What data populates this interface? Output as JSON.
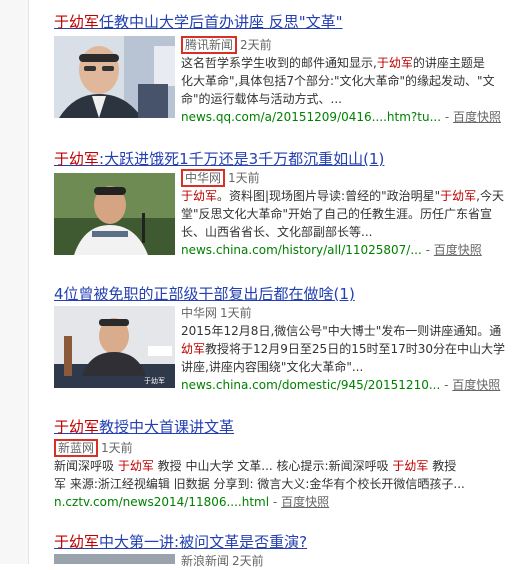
{
  "results": [
    {
      "title_parts": [
        "于幼军",
        "任教中山大学后首办讲座 反思\"文革\""
      ],
      "source": "腾讯新闻",
      "time": "2天前",
      "snippet": [
        [
          "这名哲学系学生收到的邮件通知显示,",
          "于幼军",
          "的讲座主题是"
        ],
        [
          "化大革命\",具体包括7个部分:\"文化大革命\"的缘起发动、\"文"
        ],
        [
          "命\"的运行载体与活动方式、..."
        ]
      ],
      "url": "news.qq.com/a/20151209/0416....htm?tu...",
      "cache": "百度快照"
    },
    {
      "title_parts": [
        "于幼军",
        ":大跃进饿死1千万还是3千万都沉重如山(1)"
      ],
      "source": "中华网",
      "time": "1天前",
      "snippet": [
        [
          "于幼军",
          "。资料图|现场图片导读:曾经的\"政治明星\"",
          "于幼军",
          ",今天"
        ],
        [
          "堂\"反思文化大革命\"开始了自己的任教生涯。历任广东省宣"
        ],
        [
          "长、山西省省长、文化部副部长等..."
        ]
      ],
      "url": "news.china.com/history/all/11025807/...",
      "cache": "百度快照"
    },
    {
      "title": "4位曾被免职的正部级干部复出后都在做啥(1)",
      "source": "中华网",
      "time": "1天前",
      "snippet": [
        [
          "2015年12月8日,微信公号\"中大博士\"发布一则讲座通知。通"
        ],
        [
          "幼军",
          "教授将于12月9日至25日的15时至17时30分在中山大学"
        ],
        [
          "讲座,讲座内容围绕\"文化大革命\"..."
        ]
      ],
      "url": "news.china.com/domestic/945/20151210...",
      "cache": "百度快照",
      "thumb_label": "于幼军"
    },
    {
      "title_parts": [
        "于幼军",
        "教授中大首课讲文革"
      ],
      "source": "新蓝网",
      "time": "1天前",
      "snippet": [
        [
          "新闻深呼吸 ",
          "于幼军",
          " 教授 中山大学 文革... 核心提示:新闻深呼吸 ",
          "于幼军",
          " 教授"
        ],
        [
          "军 来源:浙江经视编辑 旧数据 分享到: 微言大义:金华有个校长开微信晒孩子..."
        ]
      ],
      "url": "n.cztv.com/news2014/11806....html",
      "cache": "百度快照"
    },
    {
      "title_parts": [
        "于幼军",
        "中大第一讲:被问文革是否重演?"
      ],
      "source": "新浪新闻",
      "time": "2天前"
    }
  ],
  "colors": {
    "title": "#2440b3",
    "highlight": "#c00000",
    "url": "#008000",
    "box": "#d93025"
  }
}
